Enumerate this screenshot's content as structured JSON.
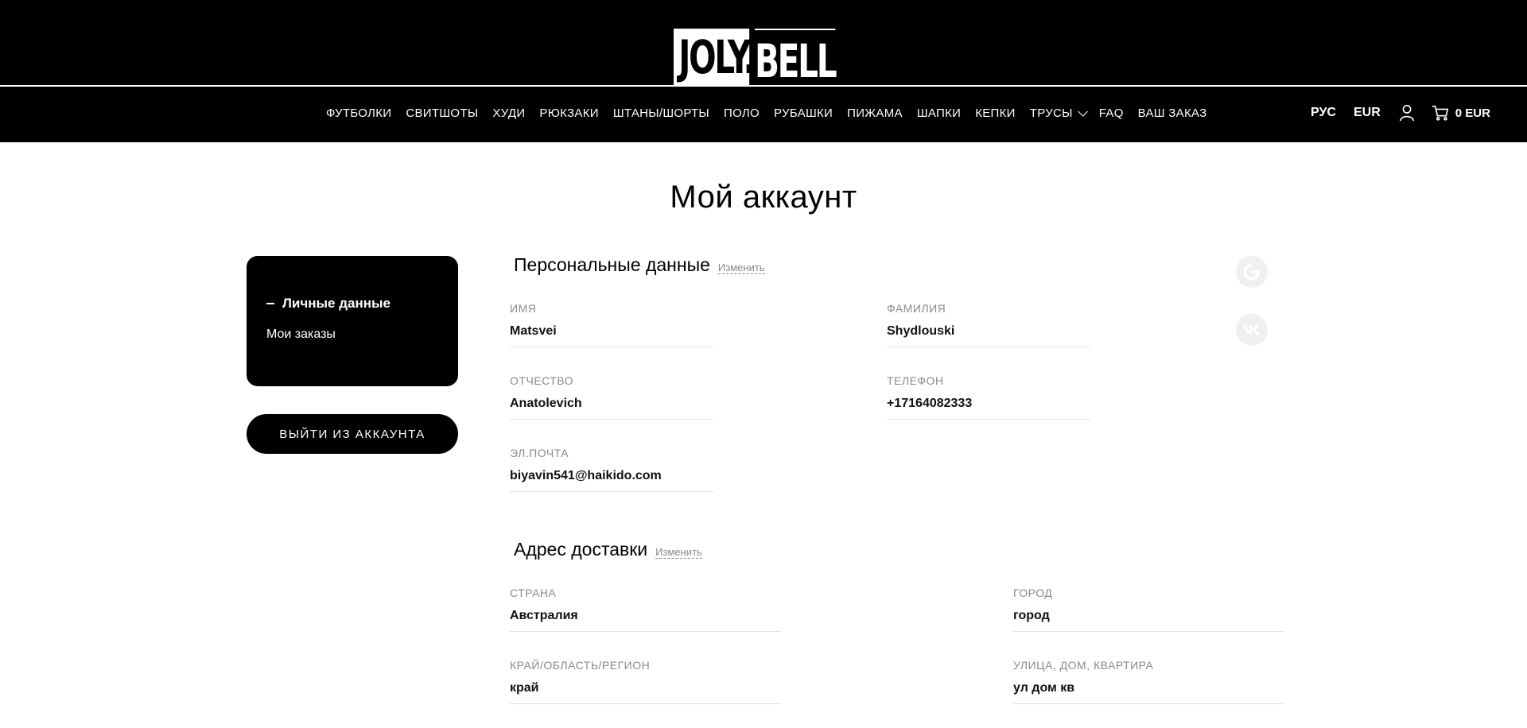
{
  "header": {
    "logo_left": "JOLY.",
    "logo_right": "BELL",
    "nav": [
      "Футболки",
      "Свитшоты",
      "Худи",
      "Рюкзаки",
      "Штаны/шорты",
      "Поло",
      "Рубашки",
      "Пижама",
      "Шапки",
      "Кепки",
      "Трусы",
      "FAQ",
      "Ваш заказ"
    ],
    "language": "РУС",
    "currency": "EUR",
    "cart_total": "0 EUR"
  },
  "page": {
    "title": "Мой аккаунт"
  },
  "sidebar": {
    "active_item": "Личные данные",
    "orders_item": "Мои заказы",
    "logout_label": "ВЫЙТИ ИЗ АККАУНТА"
  },
  "personal": {
    "title": "Персональные данные",
    "edit_label": "Изменить",
    "first_name_label": "ИМЯ",
    "first_name": "Matsvei",
    "last_name_label": "ФАМИЛИЯ",
    "last_name": "Shydlouski",
    "patronymic_label": "ОТЧЕСТВО",
    "patronymic": "Anatolevich",
    "phone_label": "ТЕЛЕФОН",
    "phone": "+17164082333",
    "email_label": "ЭЛ.ПОЧТА",
    "email": "biyavin541@haikido.com"
  },
  "address": {
    "title": "Адрес доставки",
    "edit_label": "Изменить",
    "country_label": "СТРАНА",
    "country": "Австралия",
    "city_label": "ГОРОД",
    "city": "город",
    "region_label": "КРАЙ/ОБЛАСТЬ/РЕГИОН",
    "region": "край",
    "street_label": "УЛИЦА, ДОМ, КВАРТИРА",
    "street": "ул дом кв"
  },
  "social": {
    "icons": [
      "google-icon",
      "vk-icon"
    ]
  }
}
